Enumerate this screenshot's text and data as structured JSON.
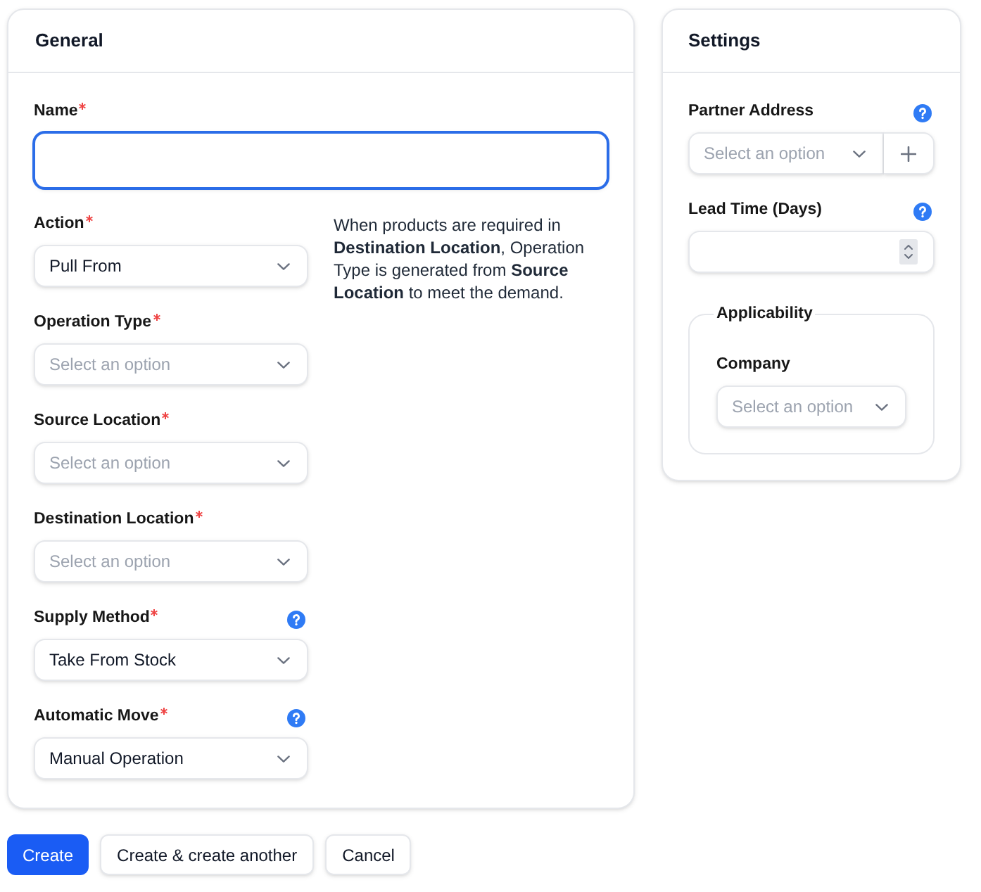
{
  "general": {
    "title": "General",
    "fields": [
      {
        "kind": "text",
        "label": "Name",
        "required": true,
        "help": false,
        "focused": true
      },
      {
        "kind": "select",
        "label": "Action",
        "required": true,
        "help": false,
        "focused": false,
        "value": "Pull From",
        "note": "When products are required in **Destination Location**, Operation Type is generated from **Source Location** to meet the demand."
      },
      {
        "kind": "select",
        "label": "Operation Type",
        "required": true,
        "help": false,
        "focused": false,
        "placeholder": "Select an option"
      },
      {
        "kind": "select",
        "label": "Source Location",
        "required": true,
        "help": false,
        "focused": false,
        "placeholder": "Select an option"
      },
      {
        "kind": "select",
        "label": "Destination Location",
        "required": true,
        "help": false,
        "focused": false,
        "placeholder": "Select an option"
      },
      {
        "kind": "select",
        "label": "Supply Method",
        "required": true,
        "help": true,
        "focused": false,
        "value": "Take From Stock"
      },
      {
        "kind": "select",
        "label": "Automatic Move",
        "required": true,
        "help": true,
        "focused": false,
        "value": "Manual Operation"
      }
    ]
  },
  "settings": {
    "title": "Settings",
    "fields": [
      {
        "kind": "select_add",
        "label": "Partner Address",
        "required": false,
        "help": true,
        "focused": false,
        "placeholder": "Select an option"
      },
      {
        "kind": "number",
        "label": "Lead Time (Days)",
        "required": false,
        "help": true,
        "focused": false
      }
    ],
    "applicability": {
      "title": "Applicability",
      "fields": [
        {
          "kind": "select",
          "label": "Company",
          "required": false,
          "help": false,
          "focused": false,
          "placeholder": "Select an option"
        }
      ]
    }
  },
  "buttons": [
    {
      "label": "Create",
      "kind": "primary"
    },
    {
      "label": "Create & create another",
      "kind": "secondary"
    },
    {
      "label": "Cancel",
      "kind": "secondary"
    }
  ]
}
